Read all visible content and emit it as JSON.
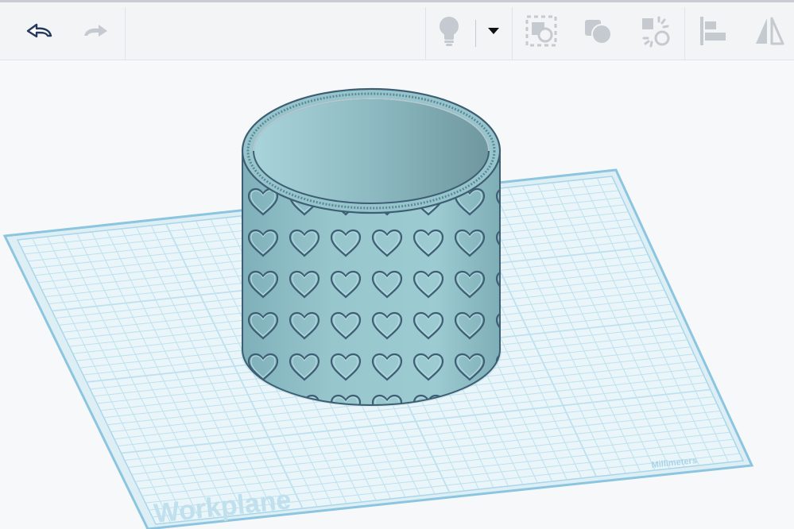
{
  "toolbar": {
    "undo": {
      "icon": "undo-arrow-icon",
      "state": "enabled"
    },
    "redo": {
      "icon": "redo-arrow-icon",
      "state": "disabled"
    },
    "light": {
      "icon": "lightbulb-icon",
      "dropdown_icon": "caret-down-icon"
    },
    "group": {
      "icon": "group-icon"
    },
    "ungroup": {
      "icon": "ungroup-icon"
    },
    "scatter": {
      "icon": "scatter-icon"
    },
    "align": {
      "icon": "align-left-icon"
    },
    "mirror": {
      "icon": "mirror-icon"
    }
  },
  "workplane": {
    "label": "Workplane",
    "units": "Millimeters"
  },
  "model": {
    "shape": "cylinder",
    "pattern": "hearts"
  },
  "colors": {
    "shape_fill": "#8fbfc6",
    "shape_dark": "#3e5e74",
    "grid_line": "#a9d6ea",
    "grid_border": "#8cc5df",
    "icon_enabled": "#263a5c",
    "icon_disabled": "#c5c9d0"
  }
}
